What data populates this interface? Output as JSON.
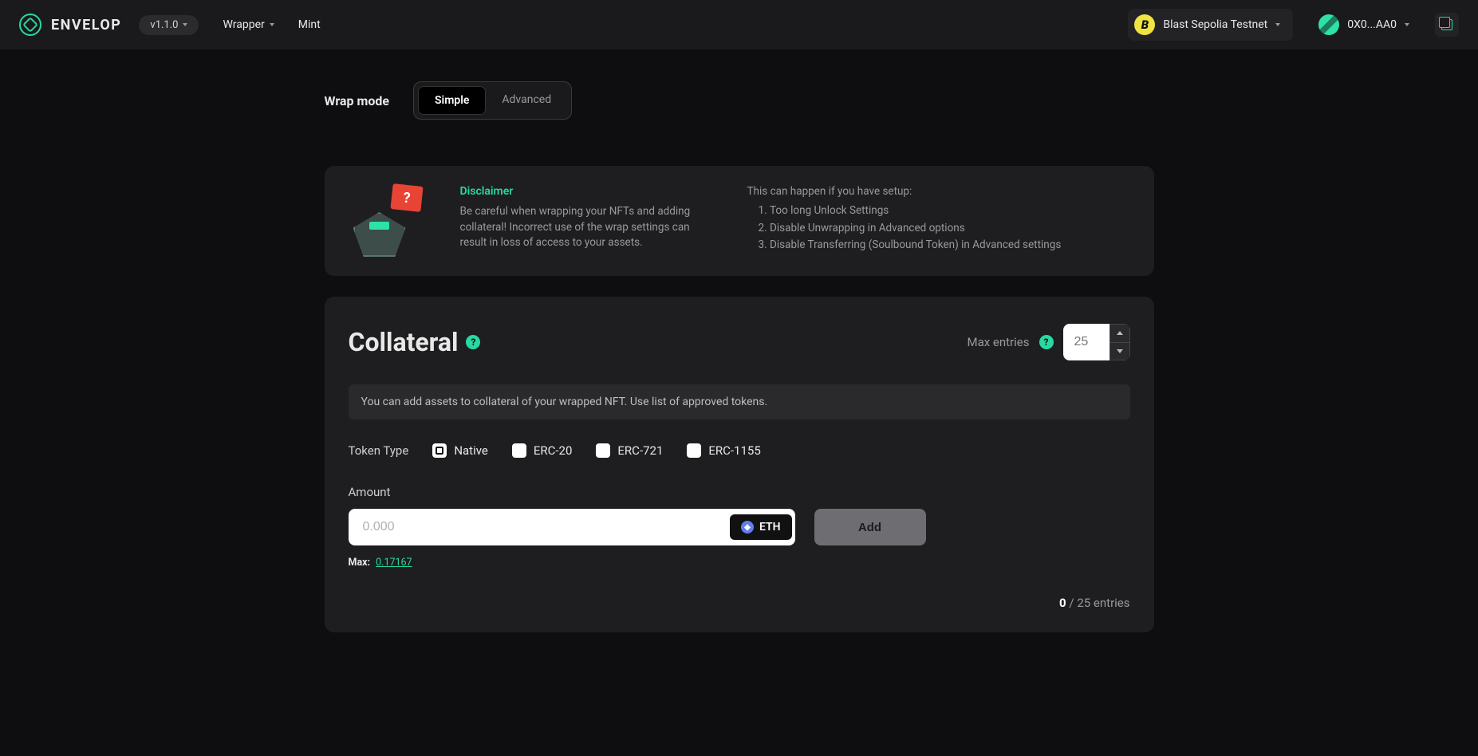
{
  "header": {
    "brand": "ENVELOP",
    "version": "v1.1.0",
    "nav": {
      "wrapper": "Wrapper",
      "mint": "Mint"
    },
    "network": "Blast Sepolia Testnet",
    "wallet": "0X0...AA0"
  },
  "wrapMode": {
    "label": "Wrap mode",
    "simple": "Simple",
    "advanced": "Advanced"
  },
  "disclaimer": {
    "title": "Disclaimer",
    "body": "Be careful when wrapping your NFTs and adding collateral! Incorrect use of the wrap settings can result in loss of access to your assets.",
    "conditionsTitle": "This can happen if you have setup:",
    "conditions": [
      "Too long Unlock Settings",
      "Disable Unwrapping in Advanced options",
      "Disable Transferring (Soulbound Token) in Advanced settings"
    ],
    "flag": "?"
  },
  "collateral": {
    "title": "Collateral",
    "help": "?",
    "maxEntriesLabel": "Max entries",
    "maxEntriesValue": "25",
    "info": "You can add assets to collateral of your wrapped NFT. Use list of approved tokens.",
    "tokenTypeLabel": "Token Type",
    "tokenTypes": {
      "native": "Native",
      "erc20": "ERC-20",
      "erc721": "ERC-721",
      "erc1155": "ERC-1155"
    },
    "amountLabel": "Amount",
    "amountPlaceholder": "0.000",
    "currency": "ETH",
    "addBtn": "Add",
    "maxLabel": "Max:",
    "maxValue": "0.17167",
    "entriesCurrent": "0",
    "entriesTotal": "25",
    "entriesSuffix": "entries"
  }
}
